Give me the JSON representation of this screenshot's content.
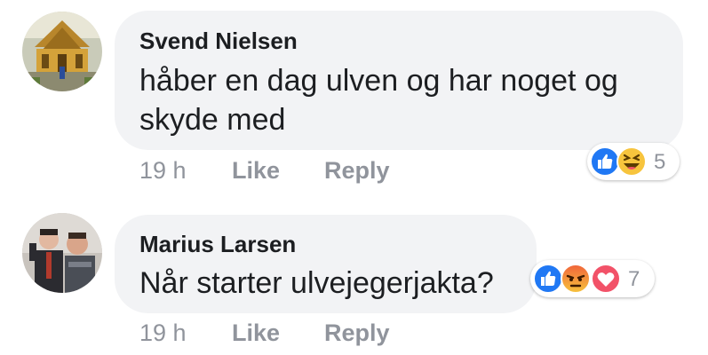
{
  "comments": [
    {
      "author": "Svend Nielsen",
      "text_lines": [
        "håber en dag ulven og har noget og",
        "skyde med"
      ],
      "time": "19 h",
      "like_label": "Like",
      "reply_label": "Reply",
      "reactions": {
        "icons": [
          "like-reaction-icon",
          "haha-reaction-icon"
        ],
        "count": "5"
      }
    },
    {
      "author": "Marius Larsen",
      "text_lines": [
        "Når starter ulvejegerjakta?"
      ],
      "time": "19 h",
      "like_label": "Like",
      "reply_label": "Reply",
      "reactions": {
        "icons": [
          "like-reaction-icon",
          "angry-reaction-icon",
          "love-reaction-icon"
        ],
        "count": "7"
      }
    }
  ],
  "colors": {
    "bubble_bg": "#f2f3f5",
    "text": "#1c1e21",
    "meta": "#90949c",
    "like_blue": "#2078f4",
    "haha_yellow": "#f7c43d",
    "angry_orange": "#f0633a",
    "love_red": "#f25268"
  }
}
